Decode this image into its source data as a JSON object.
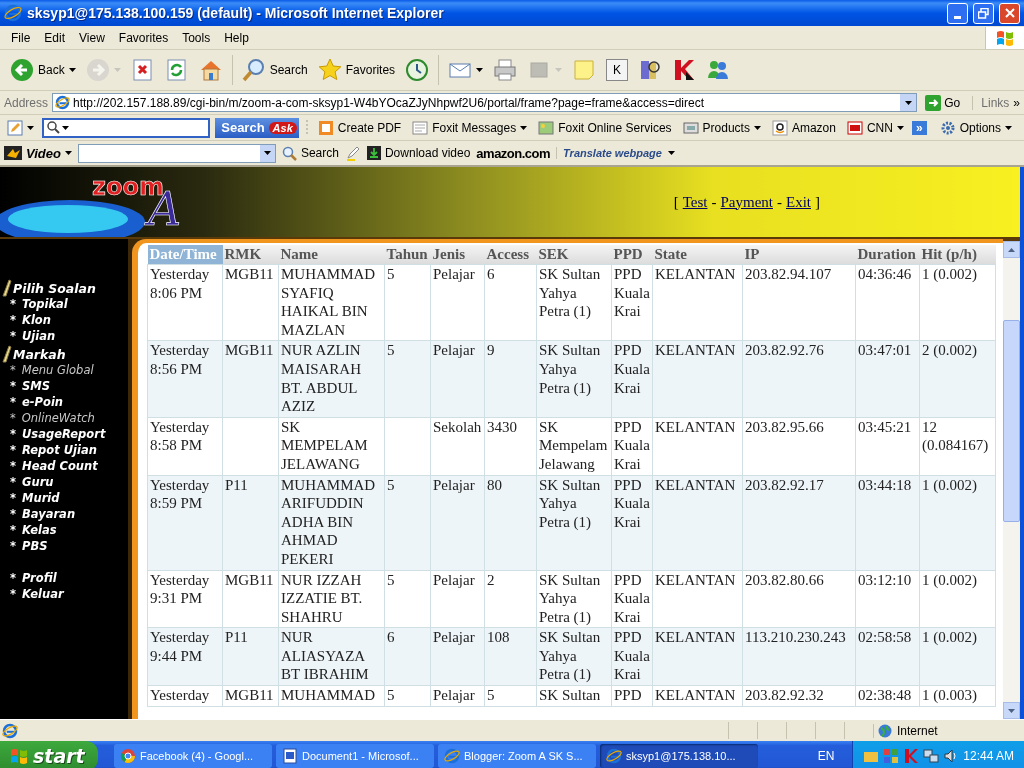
{
  "window": {
    "title": "sksyp1@175.138.100.159 (default) - Microsoft Internet Explorer"
  },
  "menu_bar": [
    "File",
    "Edit",
    "View",
    "Favorites",
    "Tools",
    "Help"
  ],
  "toolbar": [
    {
      "label": "Back",
      "dropdown": true,
      "disabled": false
    },
    {
      "dropdown": true,
      "disabled": true
    },
    {
      "dropdown": false,
      "disabled": false
    },
    {
      "dropdown": false,
      "disabled": false
    },
    {
      "dropdown": false,
      "disabled": false
    },
    {
      "label": "Search",
      "dropdown": false,
      "disabled": false
    },
    {
      "label": "Favorites",
      "dropdown": false,
      "disabled": false
    },
    {
      "dropdown": false,
      "disabled": false
    },
    {
      "dropdown": true,
      "disabled": false
    },
    {
      "dropdown": false,
      "disabled": false
    },
    {
      "dropdown": true,
      "disabled": true
    },
    {
      "dropdown": false,
      "disabled": false
    },
    {
      "label": "K",
      "dropdown": false,
      "disabled": false
    },
    {
      "dropdown": false,
      "disabled": false
    },
    {
      "dropdown": false,
      "disabled": false
    },
    {
      "dropdown": false,
      "disabled": false
    }
  ],
  "address_bar": {
    "label": "Address",
    "url": "http://202.157.188.89/cgi-bin/m/zoom-a-com-sksyp1-W4bYOcaZJyNhpwf2U6/portal/frame?page=frame&access=direct",
    "go": "Go",
    "links": "Links",
    "links_more": "»"
  },
  "ask_toolbar": {
    "search_button": "Search",
    "search_logo": "Ask",
    "items": [
      {
        "label": "Create PDF",
        "dropdown": false
      },
      {
        "label": "Foxit Messages",
        "dropdown": true
      },
      {
        "label": "Foxit Online Services",
        "dropdown": false
      },
      {
        "label": "Products",
        "dropdown": true
      },
      {
        "label": "Amazon",
        "dropdown": false
      },
      {
        "label": "CNN",
        "dropdown": true
      }
    ],
    "more": "»",
    "options": "Options"
  },
  "video_toolbar": {
    "brand": "Video",
    "search": "Search",
    "download": "Download video",
    "amazon": "amazon.com",
    "translate": "Translate webpage"
  },
  "page": {
    "logo": {
      "word": "zoom",
      "letter": "A"
    },
    "header_links": [
      {
        "kind": "text",
        "text": "["
      },
      {
        "kind": "link",
        "text": "Test"
      },
      {
        "kind": "text",
        "text": "-"
      },
      {
        "kind": "link",
        "text": "Payment"
      },
      {
        "kind": "text",
        "text": "-"
      },
      {
        "kind": "link",
        "text": "Exit"
      },
      {
        "kind": "text",
        "text": "]"
      }
    ],
    "sidebar": {
      "sections": [
        {
          "items": [
            {
              "kind": "heading",
              "label": "Pilih Soalan"
            },
            {
              "kind": "item",
              "bullet": "*",
              "label": "Topikal",
              "dimmed": false
            },
            {
              "kind": "item",
              "bullet": "*",
              "label": "Klon",
              "dimmed": false
            },
            {
              "kind": "item",
              "bullet": "*",
              "label": "Ujian",
              "dimmed": false
            },
            {
              "kind": "heading",
              "label": "Markah"
            },
            {
              "kind": "item",
              "bullet": "*",
              "label": "Menu Global",
              "dimmed": true
            },
            {
              "kind": "item",
              "bullet": "*",
              "label": "SMS",
              "dimmed": false
            },
            {
              "kind": "item",
              "bullet": "*",
              "label": "e-Poin",
              "dimmed": false
            },
            {
              "kind": "item",
              "bullet": "*",
              "label": "OnlineWatch",
              "dimmed": true
            },
            {
              "kind": "item",
              "bullet": "*",
              "label": "UsageReport",
              "dimmed": false
            },
            {
              "kind": "item",
              "bullet": "*",
              "label": "Repot Ujian",
              "dimmed": false
            },
            {
              "kind": "item",
              "bullet": "*",
              "label": "Head Count",
              "dimmed": false
            },
            {
              "kind": "item",
              "bullet": "*",
              "label": "Guru",
              "dimmed": false
            },
            {
              "kind": "item",
              "bullet": "*",
              "label": "Murid",
              "dimmed": false
            },
            {
              "kind": "item",
              "bullet": "*",
              "label": "Bayaran",
              "dimmed": false
            },
            {
              "kind": "item",
              "bullet": "*",
              "label": "Kelas",
              "dimmed": false
            },
            {
              "kind": "item",
              "bullet": "*",
              "label": "PBS",
              "dimmed": false
            }
          ]
        },
        {
          "items": [
            {
              "kind": "item",
              "bullet": "*",
              "label": "Profil",
              "dimmed": false
            },
            {
              "kind": "item",
              "bullet": "*",
              "label": "Keluar",
              "dimmed": false
            }
          ]
        }
      ]
    },
    "table": {
      "columns": [
        {
          "label": "Date/Time",
          "selected": true
        },
        {
          "label": "RMK",
          "selected": false
        },
        {
          "label": "Name",
          "selected": false
        },
        {
          "label": "Tahun",
          "selected": false
        },
        {
          "label": "Jenis",
          "selected": false
        },
        {
          "label": "Access",
          "selected": false
        },
        {
          "label": "SEK",
          "selected": false
        },
        {
          "label": "PPD",
          "selected": false
        },
        {
          "label": "State",
          "selected": false
        },
        {
          "label": "IP",
          "selected": false
        },
        {
          "label": "Duration",
          "selected": false
        },
        {
          "label": "Hit (p/h)",
          "selected": false
        }
      ],
      "rows": [
        [
          "Yesterday 8:06 PM",
          "MGB11",
          "MUHAMMAD SYAFIQ HAIKAL BIN MAZLAN",
          "5",
          "Pelajar",
          "6",
          "SK Sultan Yahya Petra (1)",
          "PPD Kuala Krai",
          "KELANTAN",
          "203.82.94.107",
          "04:36:46",
          "1 (0.002)"
        ],
        [
          "Yesterday 8:56 PM",
          "MGB11",
          "NUR AZLIN MAISARAH BT. ABDUL AZIZ",
          "5",
          "Pelajar",
          "9",
          "SK Sultan Yahya Petra (1)",
          "PPD Kuala Krai",
          "KELANTAN",
          "203.82.92.76",
          "03:47:01",
          "2 (0.002)"
        ],
        [
          "Yesterday 8:58 PM",
          null,
          "SK MEMPELAM JELAWANG",
          null,
          "Sekolah",
          "3430",
          "SK Mempelam Jelawang",
          "PPD Kuala Krai",
          "KELANTAN",
          "203.82.95.66",
          "03:45:21",
          "12 (0.084167)"
        ],
        [
          "Yesterday 8:59 PM",
          "P11",
          "MUHAMMAD ARIFUDDIN ADHA BIN AHMAD PEKERI",
          "5",
          "Pelajar",
          "80",
          "SK Sultan Yahya Petra (1)",
          "PPD Kuala Krai",
          "KELANTAN",
          "203.82.92.17",
          "03:44:18",
          "1 (0.002)"
        ],
        [
          "Yesterday 9:31 PM",
          "MGB11",
          "NUR IZZAH IZZATIE BT. SHAHRU",
          "5",
          "Pelajar",
          "2",
          "SK Sultan Yahya Petra (1)",
          "PPD Kuala Krai",
          "KELANTAN",
          "203.82.80.66",
          "03:12:10",
          "1 (0.002)"
        ],
        [
          "Yesterday 9:44 PM",
          "P11",
          "NUR ALIASYAZA BT IBRAHIM",
          "6",
          "Pelajar",
          "108",
          "SK Sultan Yahya Petra (1)",
          "PPD Kuala Krai",
          "KELANTAN",
          "113.210.230.243",
          "02:58:58",
          "1 (0.002)"
        ],
        [
          "Yesterday",
          "MGB11",
          "MUHAMMAD",
          "5",
          "Pelajar",
          "5",
          "SK Sultan",
          "PPD",
          "KELANTAN",
          "203.82.92.32",
          "02:38:48",
          "1 (0.003)"
        ]
      ]
    }
  },
  "status_bar": {
    "zone": "Internet"
  },
  "taskbar": {
    "start": "start",
    "tasks": [
      {
        "label": "Facebook (4) - Googl...",
        "selected": false
      },
      {
        "label": "Document1 - Microsof...",
        "selected": false
      },
      {
        "label": "Blogger: Zoom A SK S...",
        "selected": false
      },
      {
        "label": "sksyp1@175.138.10...",
        "selected": true
      }
    ],
    "language": "EN",
    "clock": "12:44 AM"
  }
}
